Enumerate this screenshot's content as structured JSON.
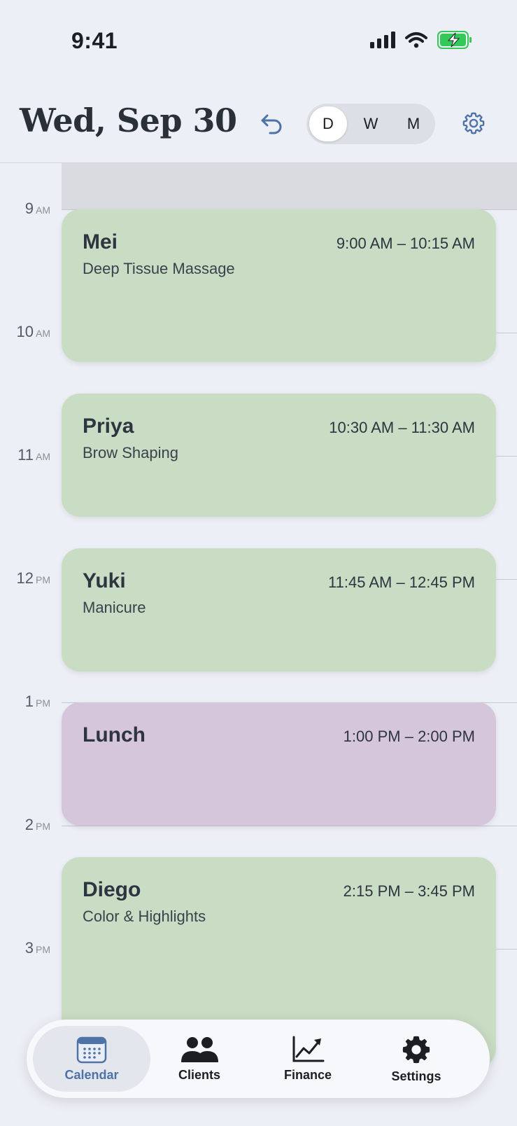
{
  "status": {
    "time": "9:41"
  },
  "header": {
    "title": "Wed, Sep 30",
    "view_options": [
      "D",
      "W",
      "M"
    ],
    "active_view": "D"
  },
  "hours": [
    {
      "num": "9",
      "ampm": "AM"
    },
    {
      "num": "10",
      "ampm": "AM"
    },
    {
      "num": "11",
      "ampm": "AM"
    },
    {
      "num": "12",
      "ampm": "PM"
    },
    {
      "num": "1",
      "ampm": "PM"
    },
    {
      "num": "2",
      "ampm": "PM"
    },
    {
      "num": "3",
      "ampm": "PM"
    }
  ],
  "appointments": [
    {
      "name": "Mei",
      "time": "9:00 AM – 10:15 AM",
      "service": "Deep Tissue Massage",
      "color": "#c9dcc4"
    },
    {
      "name": "Priya",
      "time": "10:30 AM – 11:30 AM",
      "service": "Brow Shaping",
      "color": "#c9dcc4"
    },
    {
      "name": "Yuki",
      "time": "11:45 AM – 12:45 PM",
      "service": "Manicure",
      "color": "#c9dcc4"
    },
    {
      "name": "Lunch",
      "time": "1:00 PM – 2:00 PM",
      "service": "",
      "color": "#d5c6dc"
    },
    {
      "name": "Diego",
      "time": "2:15 PM – 3:45 PM",
      "service": "Color & Highlights",
      "color": "#c9dcc4"
    }
  ],
  "tabs": [
    {
      "label": "Calendar",
      "icon": "calendar-icon",
      "active": true
    },
    {
      "label": "Clients",
      "icon": "users-icon",
      "active": false
    },
    {
      "label": "Finance",
      "icon": "chart-icon",
      "active": false
    },
    {
      "label": "Settings",
      "icon": "gear-icon",
      "active": false
    }
  ],
  "colors": {
    "accent": "#4e73a6",
    "appointment": "#c9dcc4",
    "break": "#d5c6dc",
    "background": "#eceff5"
  }
}
